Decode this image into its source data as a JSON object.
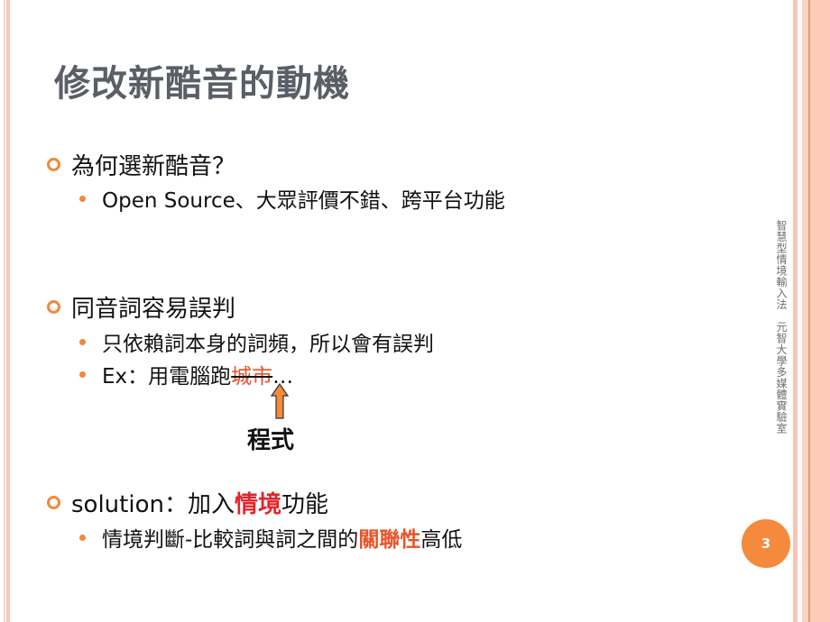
{
  "slide": {
    "title": "修改新酷音的動機",
    "footer_vertical": "智慧型情境輸入法　元智大學多媒體實驗室",
    "page_number": "3",
    "accent_color": "#F0883E",
    "sections": [
      {
        "heading": "為何選新酷音？",
        "items": [
          {
            "text": "Open Source、大眾評價不錯、跨平台功能"
          }
        ]
      },
      {
        "heading": "同音詞容易誤判",
        "items": [
          {
            "text": "只依賴詞本身的詞頻，所以會有誤判"
          },
          {
            "prefix": "Ex：用電腦跑",
            "struck": "城市",
            "suffix": "…"
          }
        ]
      },
      {
        "heading_prefix": "solution：加入",
        "heading_highlight": "情境",
        "heading_suffix": "功能",
        "items": [
          {
            "prefix": "情境判斷-比較詞與詞之間的",
            "highlight": "關聯性",
            "suffix": "高低"
          }
        ]
      }
    ],
    "correction_annotation": "程式"
  }
}
